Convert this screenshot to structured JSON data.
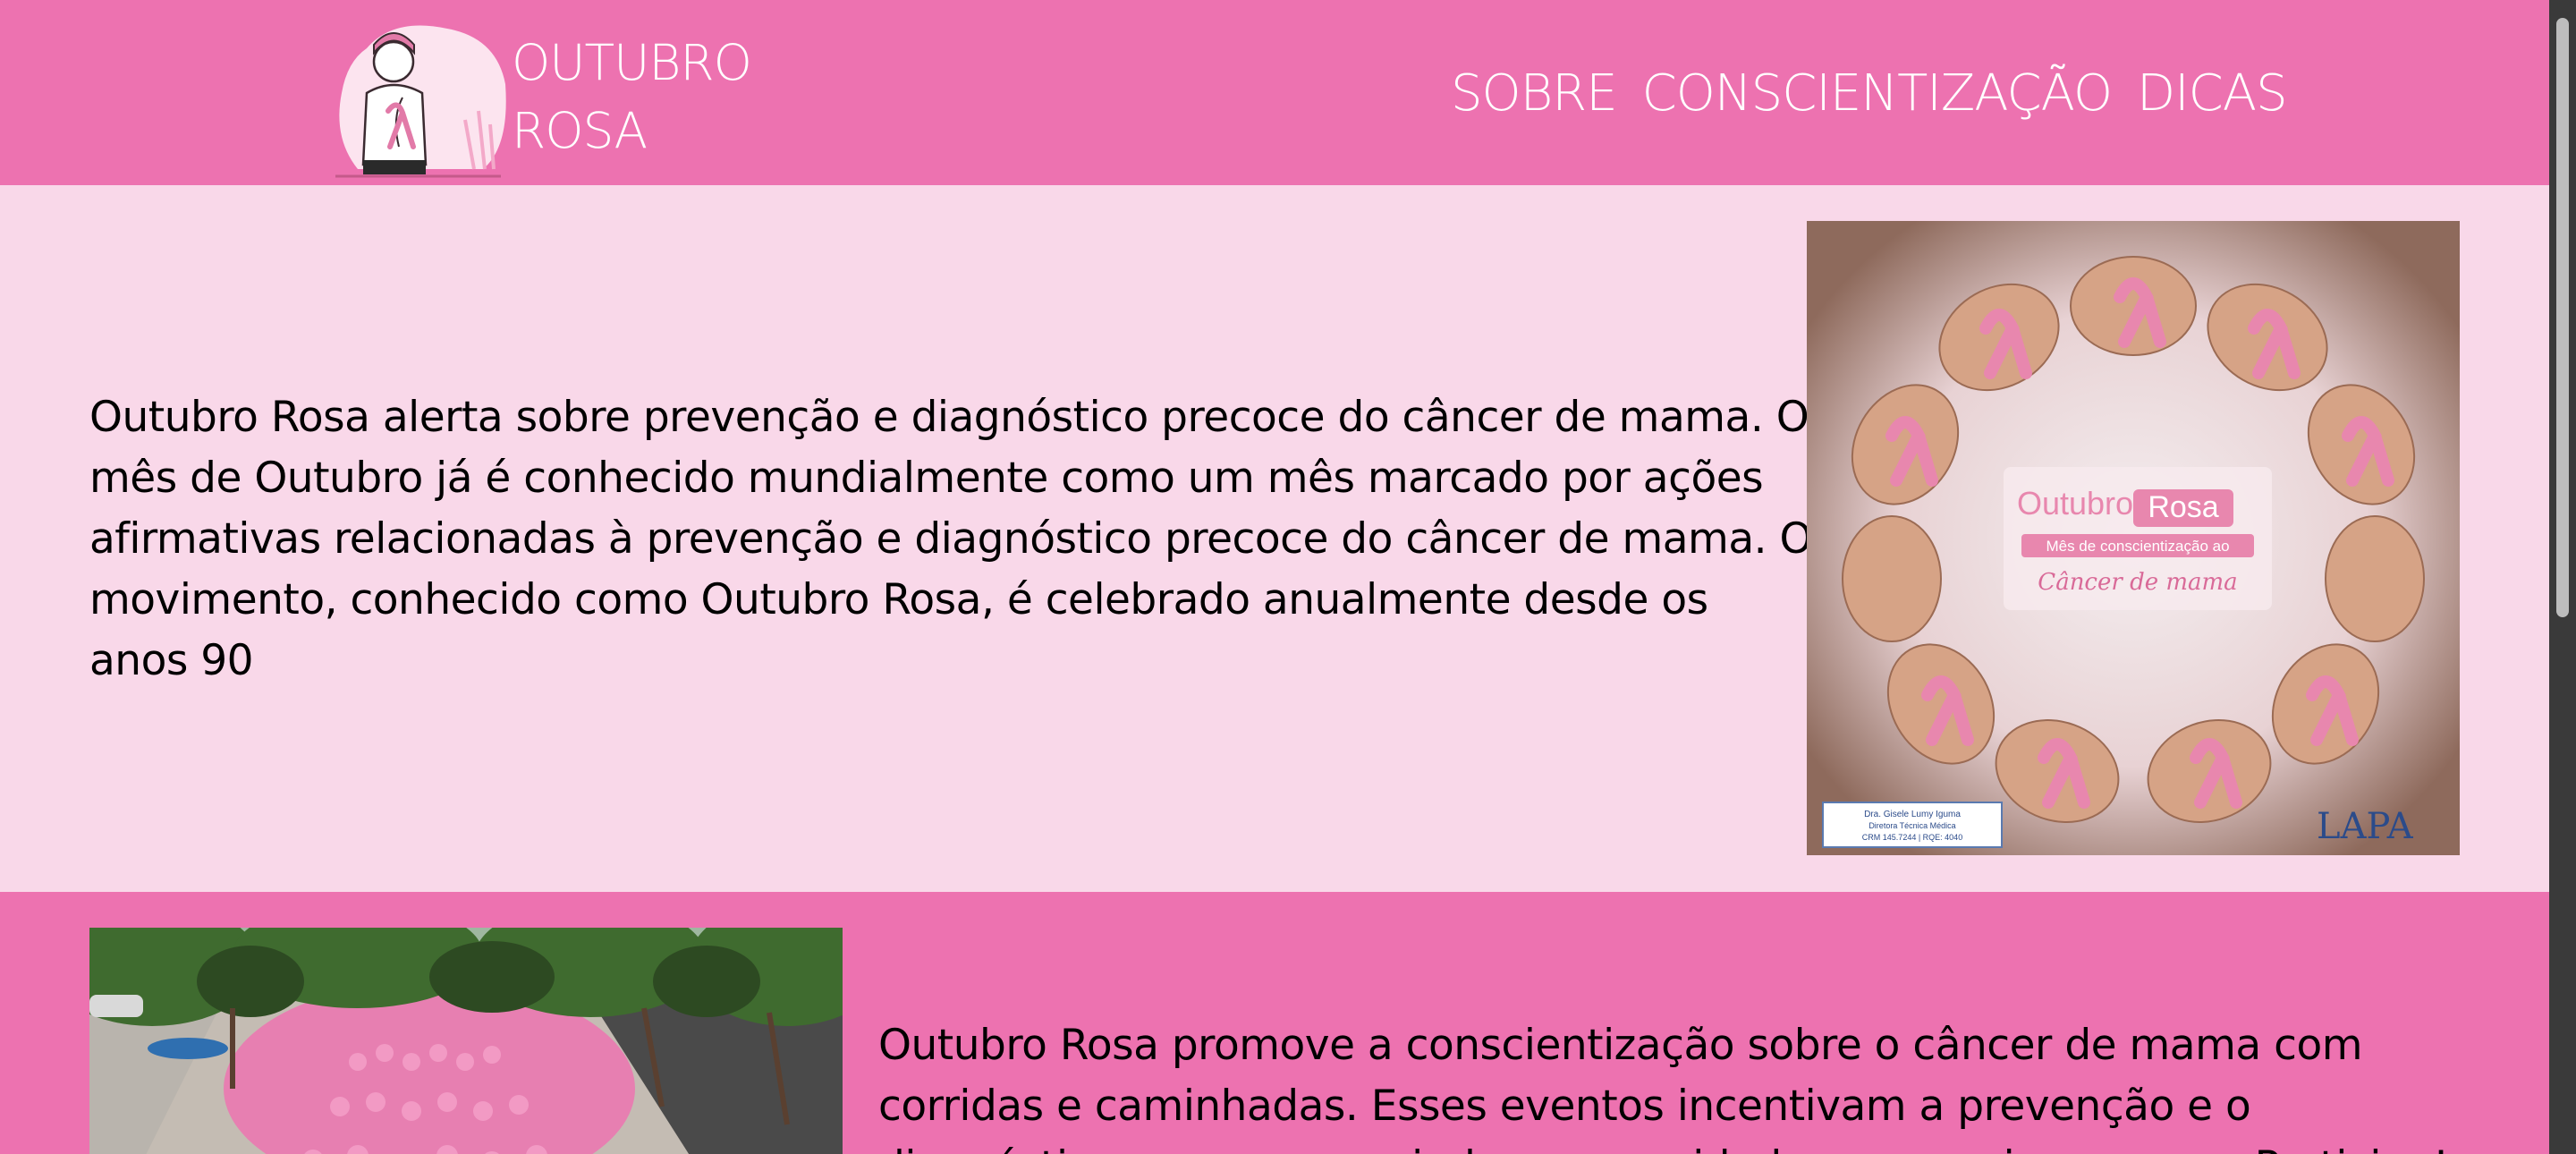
{
  "header": {
    "logo_line1": "OUTUBRO",
    "logo_line2": "ROSA",
    "nav": [
      "SOBRE",
      "CONSCIENTIZAÇÃO",
      "DICAS"
    ]
  },
  "section1": {
    "text": "Outubro Rosa alerta sobre prevenção e diagnóstico precoce do câncer de mama. O mês de Outubro já é conhecido mundialmente como um mês marcado por ações afirmativas relacionadas à prevenção e diagnóstico precoce do câncer de mama. O movimento, conhecido como Outubro Rosa, é celebrado anualmente desde os anos 90",
    "poster": {
      "title_part1": "Outubro",
      "title_part2": "Rosa",
      "subtitle": "Mês de conscientização ao",
      "script": "Câncer de mama",
      "doctor_line1": "Dra. Gisele Lumy Iguma",
      "doctor_line2": "Diretora Técnica Médica",
      "doctor_line3": "CRM 145.7244 | RQE: 4040",
      "brand": "LAPA"
    }
  },
  "section2": {
    "text": "Outubro Rosa promove a conscientização sobre o câncer de mama com corridas e caminhadas. Esses eventos incentivam a prevenção e o diagnóstico precoce, reunindo a comunidade para apoiar a causa. Participe!"
  },
  "colors": {
    "header_bg": "#ed72b0",
    "light_pink": "#f9d8e9",
    "ribbon": "#e887ae"
  }
}
